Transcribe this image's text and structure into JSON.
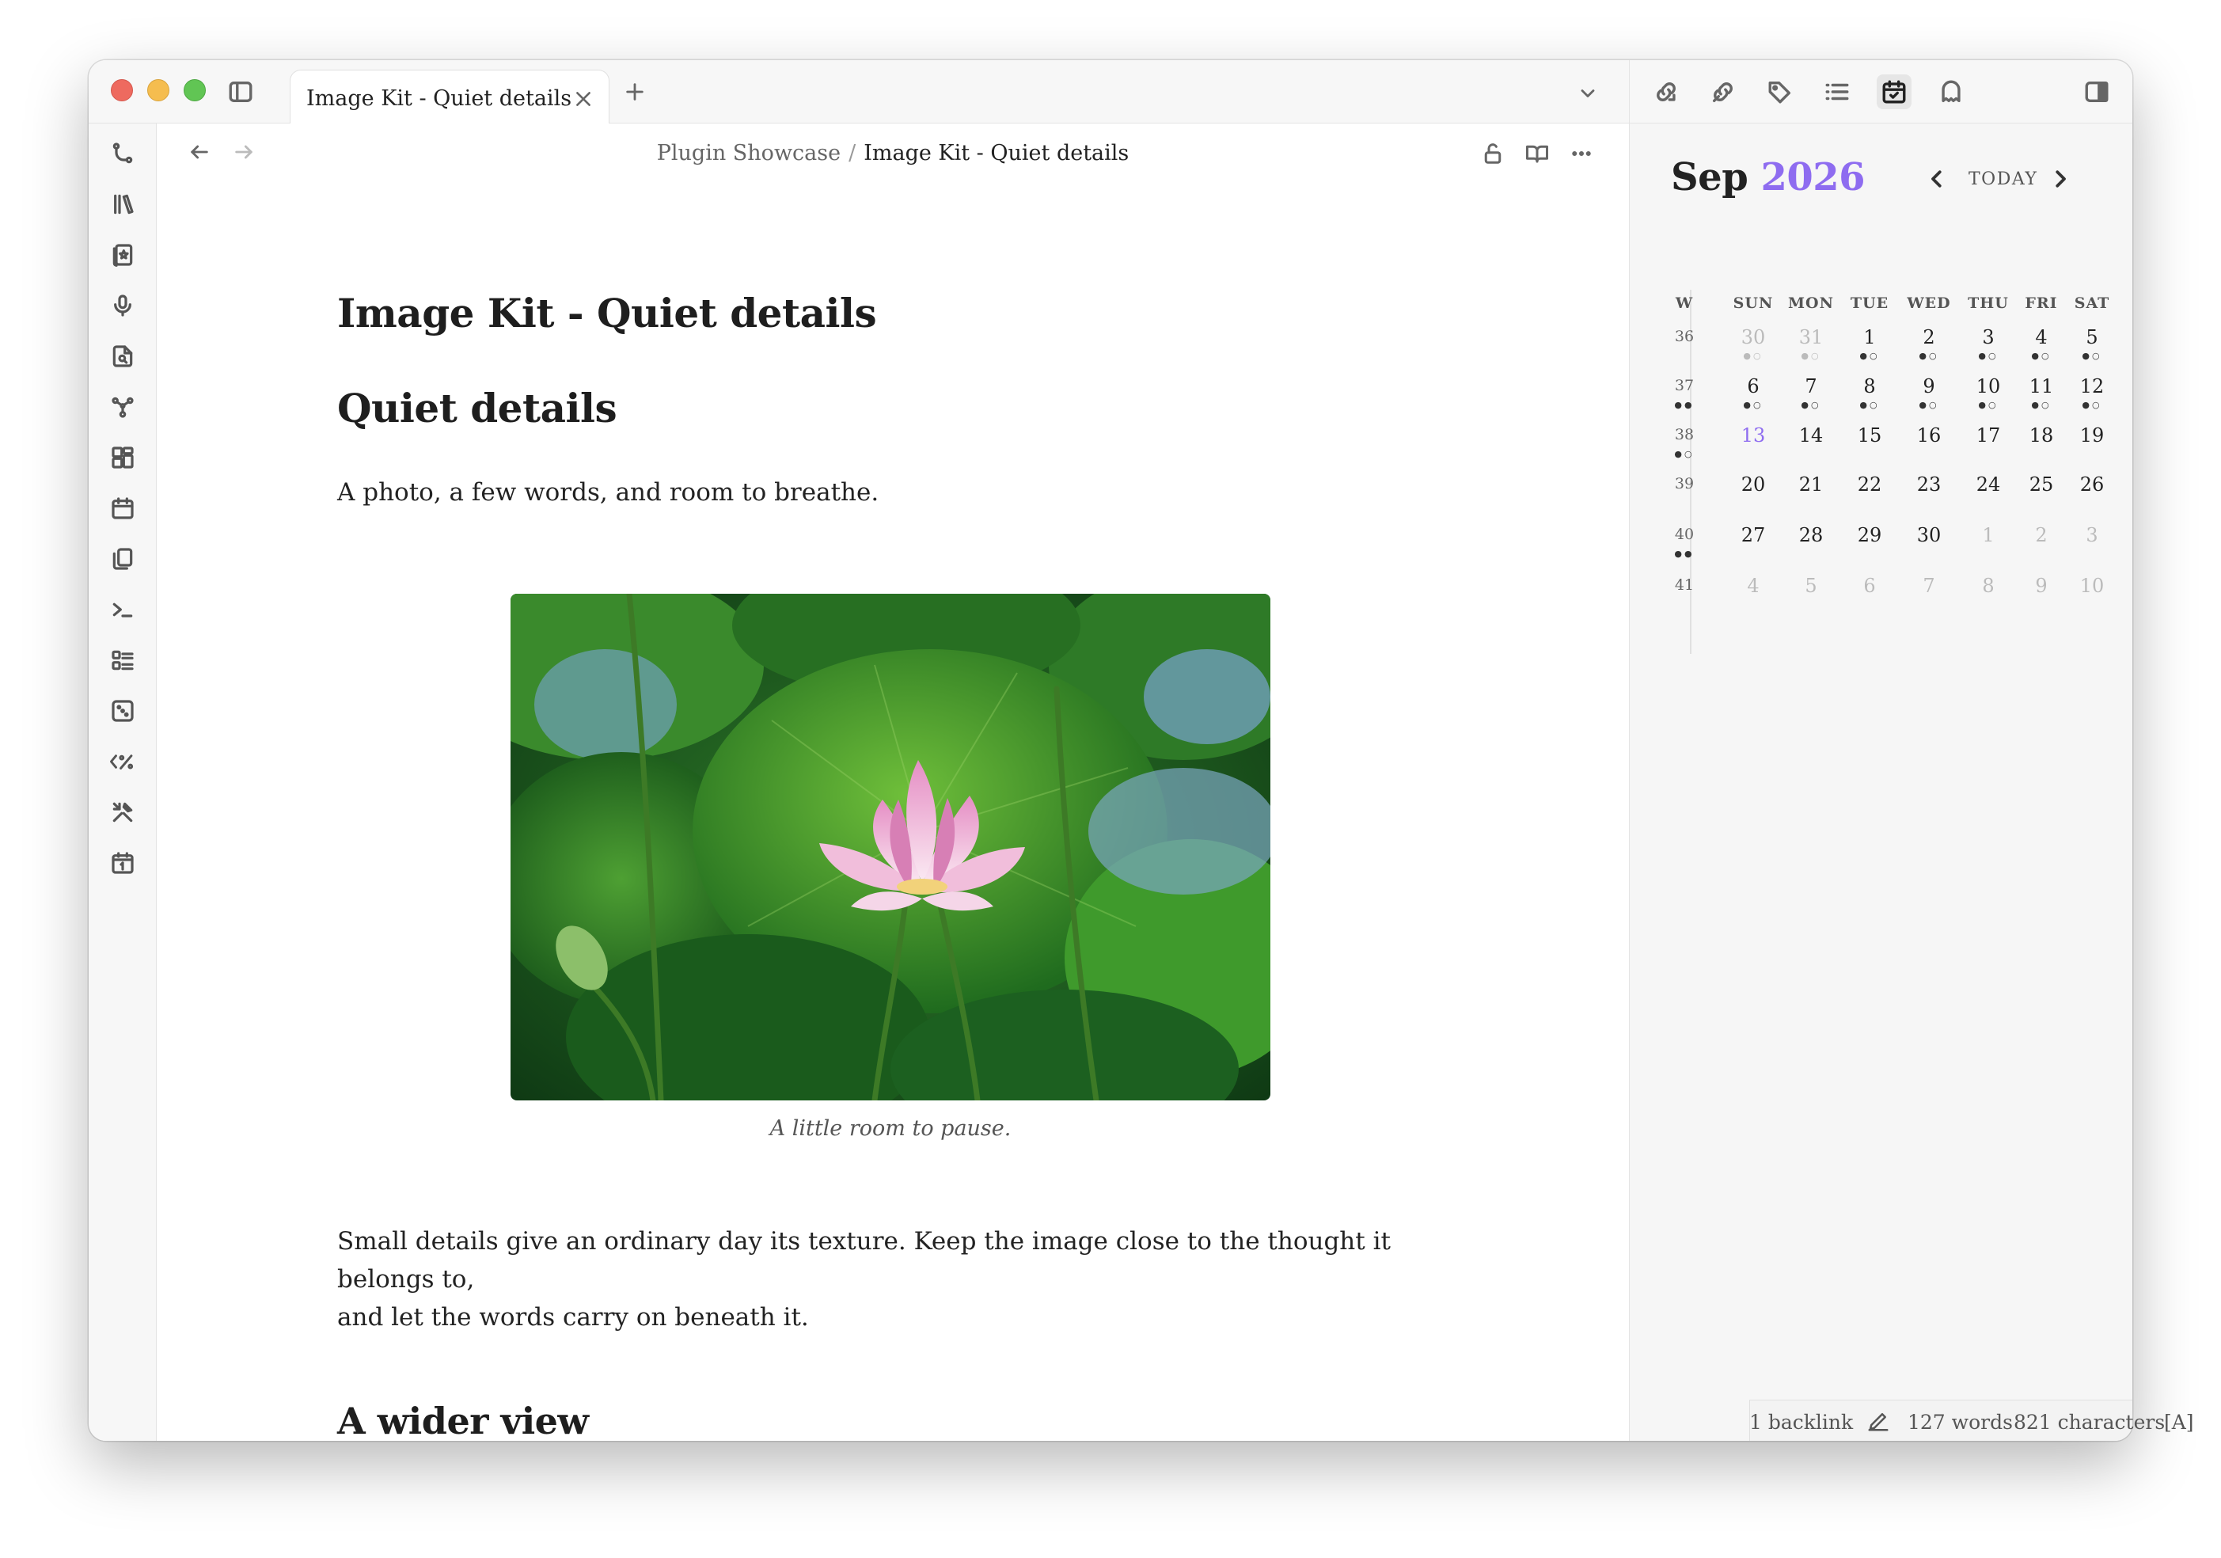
{
  "window": {
    "tab_title": "Image Kit - Quiet details"
  },
  "icons": {
    "sidebar_toggle": "sidebar-left-icon",
    "tab_close": "close-icon",
    "new_tab": "plus-icon",
    "tab_list": "chevron-down-icon",
    "right_toolbar": [
      "backlinks-icon",
      "outgoing-links-icon",
      "tag-icon",
      "outline-icon",
      "calendar-check-icon",
      "ghost-icon",
      "sidebar-right-icon"
    ],
    "ribbon": [
      "git-branch-icon",
      "library-icon",
      "starred-file-icon",
      "microphone-icon",
      "file-search-icon",
      "graph-icon",
      "dashboard-icon",
      "calendar-icon",
      "copy-icon",
      "terminal-icon",
      "checklist-icon",
      "dice-icon",
      "template-icon",
      "tools-icon",
      "daily-note-icon"
    ]
  },
  "breadcrumb": {
    "parent": "Plugin Showcase",
    "separator": "/",
    "current": "Image Kit - Quiet details"
  },
  "note": {
    "title": "Image Kit - Quiet details",
    "heading1": "Quiet details",
    "intro": "A photo, a few words, and room to breathe.",
    "image_caption": "A little room to pause.",
    "body_line1": "Small details give an ordinary day its texture. Keep the image close to the thought it belongs to,",
    "body_line2": "and let the words carry on beneath it.",
    "heading2": "A wider view"
  },
  "calendar": {
    "month": "Sep",
    "year": "2026",
    "today_label": "TODAY",
    "week_header": "W",
    "weekdays": [
      "SUN",
      "MON",
      "TUE",
      "WED",
      "THU",
      "FRI",
      "SAT"
    ],
    "weeks": [
      {
        "num": "36",
        "days": [
          "30",
          "31",
          "1",
          "2",
          "3",
          "4",
          "5"
        ]
      },
      {
        "num": "37",
        "days": [
          "6",
          "7",
          "8",
          "9",
          "10",
          "11",
          "12"
        ]
      },
      {
        "num": "38",
        "days": [
          "13",
          "14",
          "15",
          "16",
          "17",
          "18",
          "19"
        ]
      },
      {
        "num": "39",
        "days": [
          "20",
          "21",
          "22",
          "23",
          "24",
          "25",
          "26"
        ]
      },
      {
        "num": "40",
        "days": [
          "27",
          "28",
          "29",
          "30",
          "1",
          "2",
          "3"
        ]
      },
      {
        "num": "41",
        "days": [
          "4",
          "5",
          "6",
          "7",
          "8",
          "9",
          "10"
        ]
      }
    ],
    "today": "13",
    "accent_color": "#8e6cf0"
  },
  "status": {
    "backlinks": "1 backlink",
    "words": "127 words",
    "characters": "821 characters",
    "mode": "[A]"
  }
}
